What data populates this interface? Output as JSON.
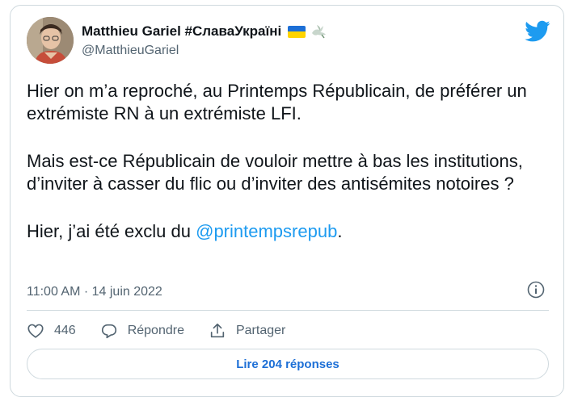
{
  "author": {
    "display_name": "Matthieu Gariel #СлаваУкраїні",
    "handle": "@MatthieuGariel",
    "flag_icon": "ukraine-flag-icon",
    "dove_icon": "dove-icon"
  },
  "brand_icon": "twitter-bird-icon",
  "tweet": {
    "paragraph_1": "Hier on m’a reproché, au Printemps Républicain, de préférer un extrémiste RN à un extrémiste LFI.",
    "paragraph_2": "Mais est-ce Républicain de vouloir mettre à bas les institutions, d’inviter à casser du flic ou d’inviter des antisémites notoires ?",
    "paragraph_3_prefix": "Hier, j’ai été exclu du ",
    "mention": "@printempsrepub",
    "paragraph_3_suffix": "."
  },
  "meta": {
    "timestamp": "11:00 AM · 14 juin 2022"
  },
  "actions": {
    "like_count": "446",
    "reply_label": "Répondre",
    "share_label": "Partager"
  },
  "read_replies_label": "Lire 204 réponses",
  "colors": {
    "accent": "#1d9bf0",
    "link_button": "#1d6fd6",
    "muted": "#536471",
    "border": "#cfd9de"
  }
}
